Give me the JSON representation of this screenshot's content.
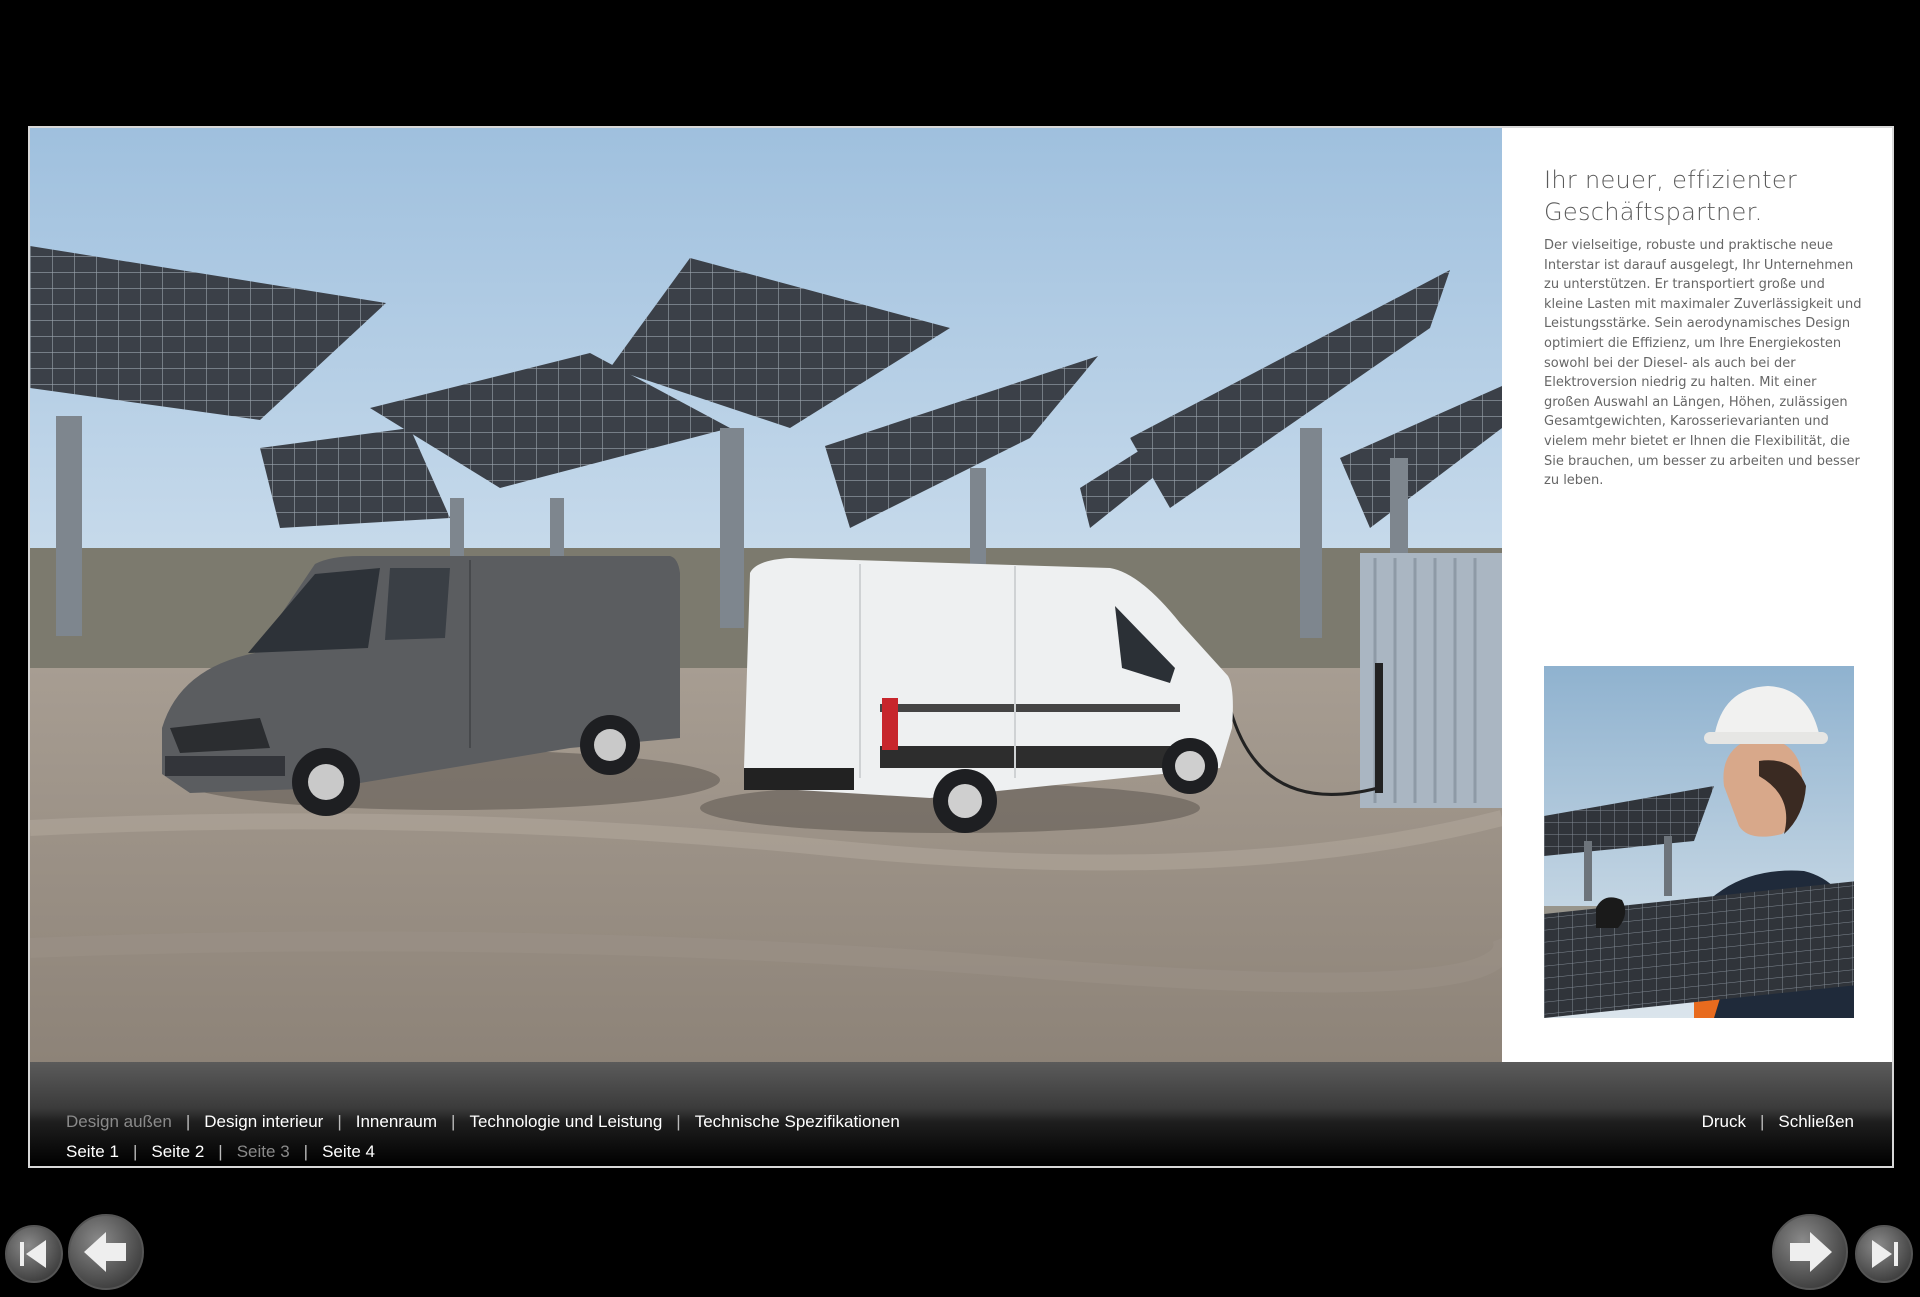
{
  "side": {
    "title_line1": "Ihr neuer, effizienter",
    "title_line2": "Geschäftspartner.",
    "body": "Der vielseitige, robuste und praktische neue Interstar ist darauf ausgelegt, Ihr Unternehmen zu unterstützen. Er transportiert große und kleine Lasten mit maximaler Zuverlässigkeit und Leistungsstärke. Sein aerodynamisches Design optimiert die Effizienz, um Ihre Energiekosten sowohl bei der Diesel- als auch bei der Elektroversion niedrig zu halten. Mit einer großen Auswahl an Längen, Höhen, zulässigen Gesamtgewichten, Karosserievarianten und vielem mehr bietet er Ihnen die Flexibilität, die Sie brauchen, um besser zu arbeiten und besser zu leben."
  },
  "nav": {
    "sections": [
      {
        "label": "Design außen",
        "active": true
      },
      {
        "label": "Design interieur",
        "active": false
      },
      {
        "label": "Innenraum",
        "active": false
      },
      {
        "label": "Technologie und Leistung",
        "active": false
      },
      {
        "label": "Technische Spezifikationen",
        "active": false
      }
    ],
    "pages": [
      {
        "label": "Seite 1",
        "active": false
      },
      {
        "label": "Seite 2",
        "active": false
      },
      {
        "label": "Seite 3",
        "active": true
      },
      {
        "label": "Seite 4",
        "active": false
      }
    ],
    "print_label": "Druck",
    "close_label": "Schließen",
    "separator": "|"
  },
  "icons": {
    "first": "skip-back-icon",
    "prev": "arrow-left-icon",
    "next": "arrow-right-icon",
    "last": "skip-forward-icon"
  },
  "colors": {
    "background": "#000000",
    "active_nav": "#8a8a8a",
    "nav_text": "#ffffff",
    "title_text": "#5a5a5a"
  }
}
